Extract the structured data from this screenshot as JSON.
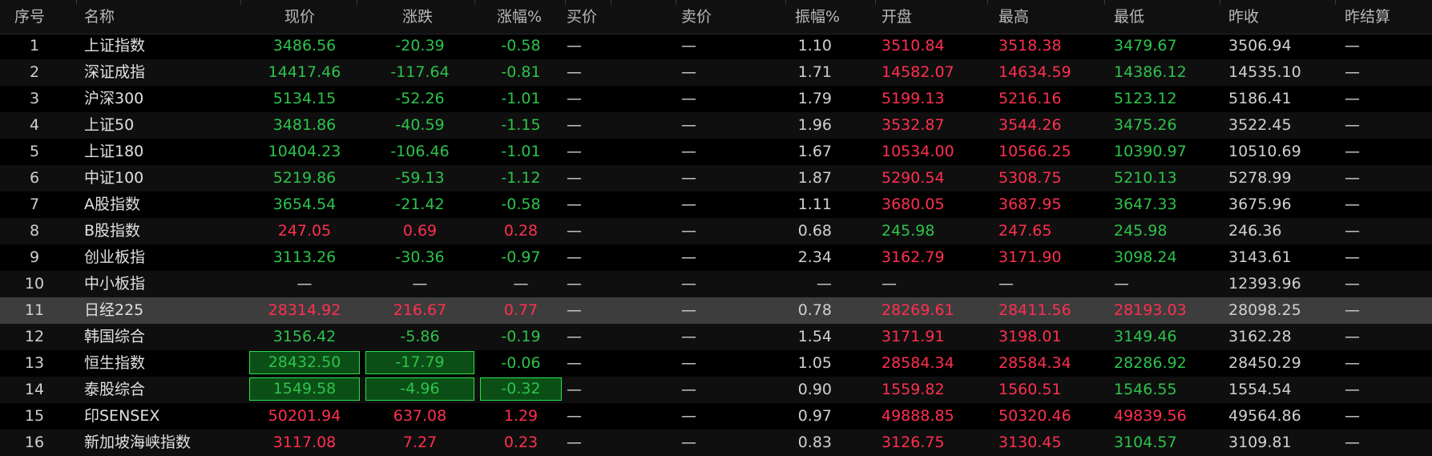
{
  "headers": [
    "序号",
    "名称",
    "现价",
    "涨跌",
    "涨幅%",
    "买价",
    "卖价",
    "振幅%",
    "开盘",
    "最高",
    "最低",
    "昨收",
    "昨结算"
  ],
  "colors": {
    "up": "#ff2f4f",
    "down": "#2cc34b",
    "neutral": "#d0d0d0",
    "selected_row": "#3d3d3d",
    "flash_border": "#2edc4d",
    "flash_fill": "#0b4f16"
  },
  "rows": [
    {
      "no": "1",
      "name": "上证指数",
      "price": "3486.56",
      "change": "-20.39",
      "pct": "-0.58",
      "bid": "—",
      "ask": "—",
      "amp": "1.10",
      "open": "3510.84",
      "high": "3518.38",
      "low": "3479.67",
      "prev": "3506.94",
      "prevset": "—",
      "colors": {
        "price": "down",
        "change": "down",
        "pct": "down",
        "open": "up",
        "high": "up",
        "low": "down"
      }
    },
    {
      "no": "2",
      "name": "深证成指",
      "price": "14417.46",
      "change": "-117.64",
      "pct": "-0.81",
      "bid": "—",
      "ask": "—",
      "amp": "1.71",
      "open": "14582.07",
      "high": "14634.59",
      "low": "14386.12",
      "prev": "14535.10",
      "prevset": "—",
      "colors": {
        "price": "down",
        "change": "down",
        "pct": "down",
        "open": "up",
        "high": "up",
        "low": "down"
      }
    },
    {
      "no": "3",
      "name": "沪深300",
      "price": "5134.15",
      "change": "-52.26",
      "pct": "-1.01",
      "bid": "—",
      "ask": "—",
      "amp": "1.79",
      "open": "5199.13",
      "high": "5216.16",
      "low": "5123.12",
      "prev": "5186.41",
      "prevset": "—",
      "colors": {
        "price": "down",
        "change": "down",
        "pct": "down",
        "open": "up",
        "high": "up",
        "low": "down"
      }
    },
    {
      "no": "4",
      "name": "上证50",
      "price": "3481.86",
      "change": "-40.59",
      "pct": "-1.15",
      "bid": "—",
      "ask": "—",
      "amp": "1.96",
      "open": "3532.87",
      "high": "3544.26",
      "low": "3475.26",
      "prev": "3522.45",
      "prevset": "—",
      "colors": {
        "price": "down",
        "change": "down",
        "pct": "down",
        "open": "up",
        "high": "up",
        "low": "down"
      }
    },
    {
      "no": "5",
      "name": "上证180",
      "price": "10404.23",
      "change": "-106.46",
      "pct": "-1.01",
      "bid": "—",
      "ask": "—",
      "amp": "1.67",
      "open": "10534.00",
      "high": "10566.25",
      "low": "10390.97",
      "prev": "10510.69",
      "prevset": "—",
      "colors": {
        "price": "down",
        "change": "down",
        "pct": "down",
        "open": "up",
        "high": "up",
        "low": "down"
      }
    },
    {
      "no": "6",
      "name": "中证100",
      "price": "5219.86",
      "change": "-59.13",
      "pct": "-1.12",
      "bid": "—",
      "ask": "—",
      "amp": "1.87",
      "open": "5290.54",
      "high": "5308.75",
      "low": "5210.13",
      "prev": "5278.99",
      "prevset": "—",
      "colors": {
        "price": "down",
        "change": "down",
        "pct": "down",
        "open": "up",
        "high": "up",
        "low": "down"
      }
    },
    {
      "no": "7",
      "name": "A股指数",
      "price": "3654.54",
      "change": "-21.42",
      "pct": "-0.58",
      "bid": "—",
      "ask": "—",
      "amp": "1.11",
      "open": "3680.05",
      "high": "3687.95",
      "low": "3647.33",
      "prev": "3675.96",
      "prevset": "—",
      "colors": {
        "price": "down",
        "change": "down",
        "pct": "down",
        "open": "up",
        "high": "up",
        "low": "down"
      }
    },
    {
      "no": "8",
      "name": "B股指数",
      "price": "247.05",
      "change": "0.69",
      "pct": "0.28",
      "bid": "—",
      "ask": "—",
      "amp": "0.68",
      "open": "245.98",
      "high": "247.65",
      "low": "245.98",
      "prev": "246.36",
      "prevset": "—",
      "colors": {
        "price": "up",
        "change": "up",
        "pct": "up",
        "open": "down",
        "high": "up",
        "low": "down"
      }
    },
    {
      "no": "9",
      "name": "创业板指",
      "price": "3113.26",
      "change": "-30.36",
      "pct": "-0.97",
      "bid": "—",
      "ask": "—",
      "amp": "2.34",
      "open": "3162.79",
      "high": "3171.90",
      "low": "3098.24",
      "prev": "3143.61",
      "prevset": "—",
      "colors": {
        "price": "down",
        "change": "down",
        "pct": "down",
        "open": "up",
        "high": "up",
        "low": "down"
      }
    },
    {
      "no": "10",
      "name": "中小板指",
      "price": "—",
      "change": "—",
      "pct": "—",
      "bid": "—",
      "ask": "—",
      "amp": "—",
      "open": "—",
      "high": "—",
      "low": "—",
      "prev": "12393.96",
      "prevset": "—",
      "colors": {
        "price": "flat",
        "change": "flat",
        "pct": "flat",
        "open": "flat",
        "high": "flat",
        "low": "flat"
      }
    },
    {
      "no": "11",
      "name": "日经225",
      "price": "28314.92",
      "change": "216.67",
      "pct": "0.77",
      "bid": "—",
      "ask": "—",
      "amp": "0.78",
      "open": "28269.61",
      "high": "28411.56",
      "low": "28193.03",
      "prev": "28098.25",
      "prevset": "—",
      "selected": true,
      "colors": {
        "price": "up",
        "change": "up",
        "pct": "up",
        "open": "up",
        "high": "up",
        "low": "up"
      }
    },
    {
      "no": "12",
      "name": "韩国综合",
      "price": "3156.42",
      "change": "-5.86",
      "pct": "-0.19",
      "bid": "—",
      "ask": "—",
      "amp": "1.54",
      "open": "3171.91",
      "high": "3198.01",
      "low": "3149.46",
      "prev": "3162.28",
      "prevset": "—",
      "colors": {
        "price": "down",
        "change": "down",
        "pct": "down",
        "open": "up",
        "high": "up",
        "low": "down"
      }
    },
    {
      "no": "13",
      "name": "恒生指数",
      "price": "28432.50",
      "change": "-17.79",
      "pct": "-0.06",
      "bid": "—",
      "ask": "—",
      "amp": "1.05",
      "open": "28584.34",
      "high": "28584.34",
      "low": "28286.92",
      "prev": "28450.29",
      "prevset": "—",
      "flash": [
        "price",
        "change"
      ],
      "colors": {
        "price": "down",
        "change": "down",
        "pct": "down",
        "open": "up",
        "high": "up",
        "low": "down"
      }
    },
    {
      "no": "14",
      "name": "泰股综合",
      "price": "1549.58",
      "change": "-4.96",
      "pct": "-0.32",
      "bid": "—",
      "ask": "—",
      "amp": "0.90",
      "open": "1559.82",
      "high": "1560.51",
      "low": "1546.55",
      "prev": "1554.54",
      "prevset": "—",
      "flash": [
        "price",
        "change",
        "pct"
      ],
      "colors": {
        "price": "down",
        "change": "down",
        "pct": "down",
        "open": "up",
        "high": "up",
        "low": "down"
      }
    },
    {
      "no": "15",
      "name": "印SENSEX",
      "price": "50201.94",
      "change": "637.08",
      "pct": "1.29",
      "bid": "—",
      "ask": "—",
      "amp": "0.97",
      "open": "49888.85",
      "high": "50320.46",
      "low": "49839.56",
      "prev": "49564.86",
      "prevset": "—",
      "colors": {
        "price": "up",
        "change": "up",
        "pct": "up",
        "open": "up",
        "high": "up",
        "low": "up"
      }
    },
    {
      "no": "16",
      "name": "新加坡海峡指数",
      "price": "3117.08",
      "change": "7.27",
      "pct": "0.23",
      "bid": "—",
      "ask": "—",
      "amp": "0.83",
      "open": "3126.75",
      "high": "3130.45",
      "low": "3104.57",
      "prev": "3109.81",
      "prevset": "—",
      "colors": {
        "price": "up",
        "change": "up",
        "pct": "up",
        "open": "up",
        "high": "up",
        "low": "down"
      }
    }
  ]
}
